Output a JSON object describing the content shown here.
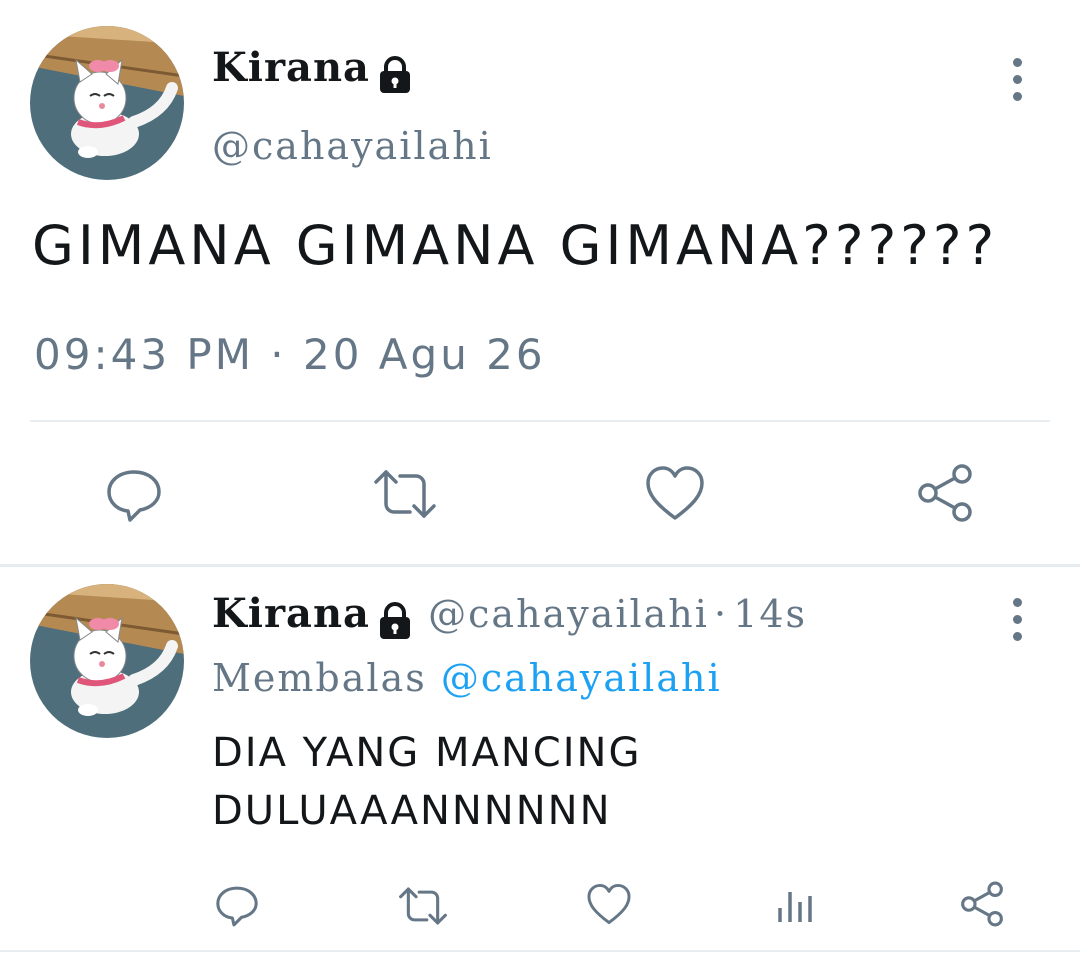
{
  "main_tweet": {
    "display_name": "Kirana",
    "handle": "@cahayailahi",
    "text": "GIMANA GIMANA GIMANA??????",
    "timestamp": "09:43 PM · 20 Agu 26"
  },
  "reply_tweet": {
    "display_name": "Kirana",
    "handle": "@cahayailahi",
    "separator": "·",
    "age": "14s",
    "reply_prefix": "Membalas",
    "reply_to": "@cahayailahi",
    "text_line1": "DIA YANG MANCING",
    "text_line2": "DULUAAANNNNNN"
  },
  "icons": {
    "main_actions": [
      "reply-icon",
      "retweet-icon",
      "like-icon",
      "share-icon"
    ],
    "reply_actions": [
      "reply-icon",
      "retweet-icon",
      "like-icon",
      "analytics-icon",
      "share-icon"
    ],
    "lock": "lock-icon",
    "more": "more-vertical-icon"
  },
  "colors": {
    "text": "#14171a",
    "secondary": "#657786",
    "link": "#1da1f2",
    "divider": "#e6ecf0"
  }
}
